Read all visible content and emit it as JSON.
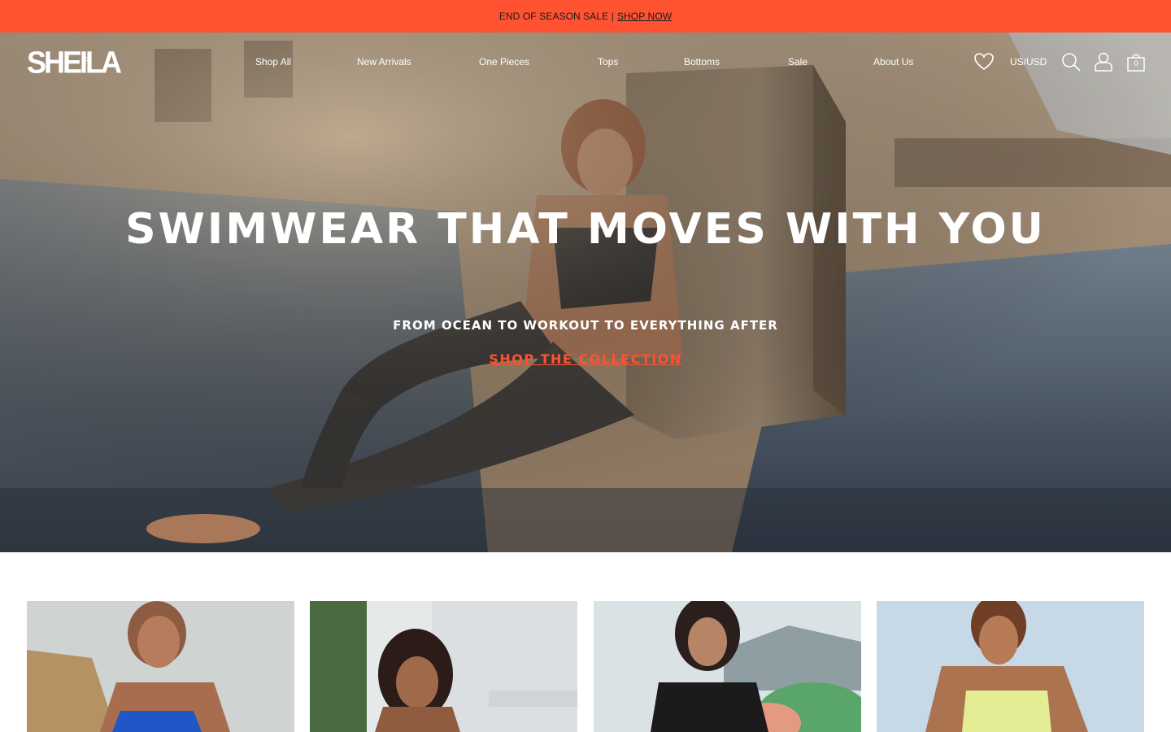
{
  "announcement": {
    "text": "END OF SEASON SALE |",
    "link_label": "SHOP NOW"
  },
  "brand": {
    "logo_text": "SHEILA",
    "logo_mark": "®"
  },
  "nav": {
    "items": [
      {
        "label": "Shop All"
      },
      {
        "label": "New Arrivals"
      },
      {
        "label": "One Pieces"
      },
      {
        "label": "Tops"
      },
      {
        "label": "Bottoms"
      },
      {
        "label": "Sale"
      },
      {
        "label": "About Us"
      }
    ]
  },
  "tools": {
    "wishlist_icon": "heart-icon",
    "currency": "US/USD",
    "search_icon": "search-icon",
    "account_icon": "user-icon",
    "cart_icon": "bag-icon",
    "cart_count": "0"
  },
  "hero": {
    "title": "SWIMWEAR THAT MOVES WITH YOU",
    "subtitle": "FROM OCEAN TO WORKOUT TO EVERYTHING AFTER",
    "cta": "SHOP THE COLLECTION"
  },
  "colors": {
    "accent": "#ff5231",
    "text_on_image": "#ffffff"
  },
  "cards": [
    {
      "alt": "Model in blue swimsuit"
    },
    {
      "alt": "Model in green swimsuit"
    },
    {
      "alt": "Model in black shirt"
    },
    {
      "alt": "Model in yellow swimsuit"
    }
  ]
}
